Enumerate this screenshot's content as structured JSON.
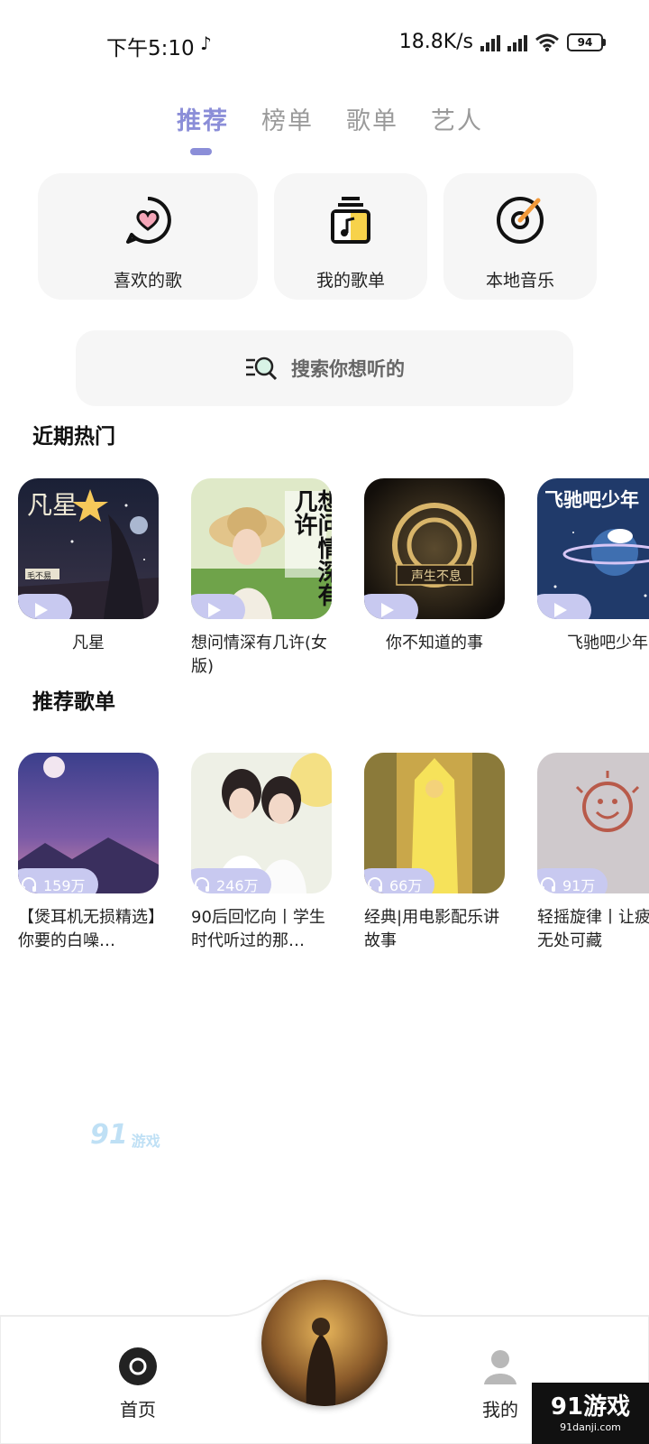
{
  "status_bar": {
    "time": "下午5:10",
    "tiktok_icon": "tiktok-icon",
    "net_speed": "18.8K/s",
    "battery": "94"
  },
  "tabs": [
    {
      "label": "推荐",
      "active": true
    },
    {
      "label": "榜单",
      "active": false
    },
    {
      "label": "歌单",
      "active": false
    },
    {
      "label": "艺人",
      "active": false
    }
  ],
  "quick_actions": [
    {
      "label": "喜欢的歌",
      "icon": "heart-chat-icon"
    },
    {
      "label": "我的歌单",
      "icon": "playlist-icon"
    },
    {
      "label": "本地音乐",
      "icon": "disc-icon"
    }
  ],
  "search": {
    "placeholder": "搜索你想听的"
  },
  "recent_hot": {
    "title": "近期热门",
    "items": [
      {
        "title": "凡星",
        "cover_text": "凡星",
        "cover_sub": "毛不易"
      },
      {
        "title": "想问情深有几许(女版)",
        "cover_text": "想问情深有几许"
      },
      {
        "title": "你不知道的事",
        "cover_text": "声生不息"
      },
      {
        "title": "飞驰吧少年",
        "cover_text": "飞驰吧少年"
      }
    ]
  },
  "recommended_playlists": {
    "title": "推荐歌单",
    "items": [
      {
        "plays": "159万",
        "title": "【煲耳机无损精选】你要的白噪…"
      },
      {
        "plays": "246万",
        "title": "90后回忆向丨学生时代听过的那…"
      },
      {
        "plays": "66万",
        "title": "经典|用电影配乐讲故事"
      },
      {
        "plays": "91万",
        "title": "轻摇旋律丨让疲惫无处可藏"
      }
    ]
  },
  "watermark": {
    "num": "91",
    "text": "游戏",
    "site": "91danji.com"
  },
  "bottom_nav": {
    "home_label": "首页",
    "me_label": "我的"
  },
  "corner_watermark": {
    "title": "91游戏",
    "site": "91danji.com"
  },
  "colors": {
    "accent": "#8b8ed8",
    "pill": "#c8c9f0",
    "card_bg": "#f6f6f6"
  }
}
